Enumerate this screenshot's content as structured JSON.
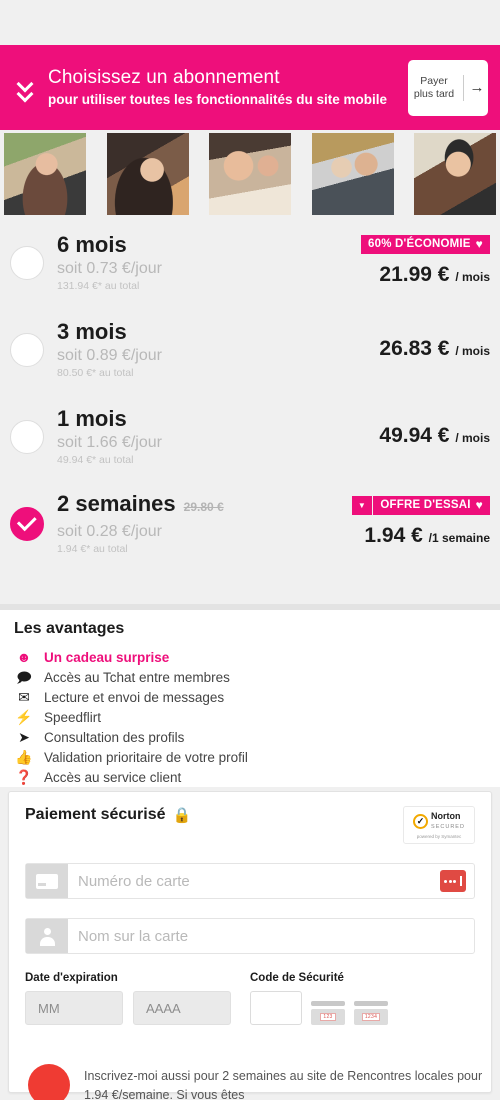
{
  "banner": {
    "line1": "Choisissez un abonnement",
    "line2": "pour utiliser toutes les fonctionnalités du site mobile",
    "later_label": "Payer plus tard",
    "later_arrow": "→",
    "color": "#ee0f7b"
  },
  "photos": [
    {
      "name": "profile-photo-1"
    },
    {
      "name": "profile-photo-2"
    },
    {
      "name": "profile-photo-3"
    },
    {
      "name": "profile-photo-4"
    },
    {
      "name": "profile-photo-5"
    }
  ],
  "plans": [
    {
      "title": "6 mois",
      "strike": "",
      "per_day": "soit 0.73 €/jour",
      "total": "131.94 €* au total",
      "badge": "60% D'ÉCONOMIE",
      "badge_caret": false,
      "price": "21.99 €",
      "per": "/ mois",
      "selected": false
    },
    {
      "title": "3 mois",
      "strike": "",
      "per_day": "soit 0.89 €/jour",
      "total": "80.50 €* au total",
      "badge": "",
      "badge_caret": false,
      "price": "26.83 €",
      "per": "/ mois",
      "selected": false
    },
    {
      "title": "1 mois",
      "strike": "",
      "per_day": "soit 1.66 €/jour",
      "total": "49.94 €* au total",
      "badge": "",
      "badge_caret": false,
      "price": "49.94 €",
      "per": "/ mois",
      "selected": false
    },
    {
      "title": "2 semaines",
      "strike": "29.80 €",
      "per_day": "soit 0.28 €/jour",
      "total": "1.94 €* au total",
      "badge": "OFFRE D'ESSAI",
      "badge_caret": true,
      "price": "1.94 €",
      "per": "/1 semaine",
      "selected": true
    }
  ],
  "advantages": {
    "title": "Les avantages",
    "items": [
      {
        "icon": "smiley-icon",
        "glyph": "☻",
        "label": "Un cadeau surprise",
        "highlight": true
      },
      {
        "icon": "chat-bubble-icon",
        "glyph": "💬",
        "label": "Accès au Tchat entre membres",
        "highlight": false
      },
      {
        "icon": "envelope-icon",
        "glyph": "✉",
        "label": "Lecture et envoi de messages",
        "highlight": false
      },
      {
        "icon": "lightning-bolt-icon",
        "glyph": "⚡",
        "label": "Speedflirt",
        "highlight": false
      },
      {
        "icon": "paper-plane-icon",
        "glyph": "➤",
        "label": "Consultation des profils",
        "highlight": false
      },
      {
        "icon": "thumbs-up-icon",
        "glyph": "👍",
        "label": "Validation prioritaire de votre profil",
        "highlight": false
      },
      {
        "icon": "question-mark-icon",
        "glyph": "?",
        "label": "Accès au service client",
        "highlight": false
      }
    ]
  },
  "payment": {
    "title": "Paiement sécurisé",
    "lock_glyph": "🔒",
    "norton": {
      "check": "✓",
      "name": "Norton",
      "sub": "SECURED",
      "powered": "powered by Symantec"
    },
    "card_number_placeholder": "Numéro de carte",
    "card_number_value": "",
    "card_name_placeholder": "Nom sur la carte",
    "card_name_value": "",
    "expiry_label": "Date d'expiration",
    "expiry_month": "MM",
    "expiry_year": "AAAA",
    "cvv_label": "Code de Sécurité",
    "cvv_value": "",
    "cvv_hint_amex": "1234",
    "cvv_hint_visa": "123"
  },
  "consent": {
    "text": "Inscrivez-moi aussi pour 2 semaines au site de Rencontres locales pour 1.94 €/semaine. Si vous êtes"
  }
}
